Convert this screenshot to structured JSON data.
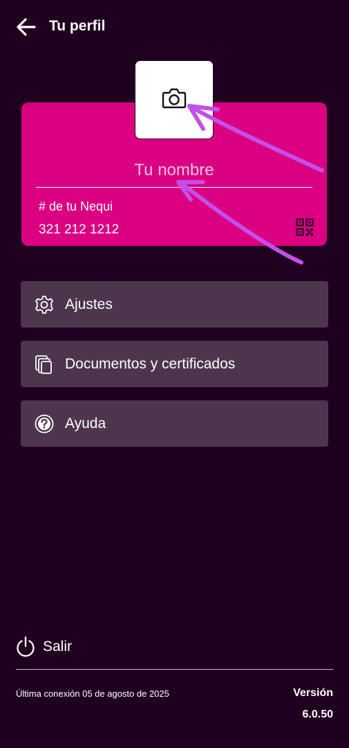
{
  "header": {
    "title": "Tu perfil",
    "back_icon": "arrow-left-icon"
  },
  "card": {
    "name_placeholder": "Tu nombre",
    "nequi_label": "# de tu Nequi",
    "nequi_number": "321 212 1212",
    "camera_icon": "camera-icon",
    "qr_icon": "qr-code-icon",
    "background_color": "#DA0081"
  },
  "menu": {
    "items": [
      {
        "label": "Ajustes",
        "icon": "gear-icon"
      },
      {
        "label": "Documentos y certificados",
        "icon": "documents-icon"
      },
      {
        "label": "Ayuda",
        "icon": "help-icon"
      }
    ]
  },
  "footer": {
    "logout_label": "Salir",
    "logout_icon": "power-icon",
    "last_connection": "Última conexión 05 de agosto de 2025",
    "version_label": "Versión",
    "version_number": "6.0.50"
  },
  "colors": {
    "background": "#200020",
    "menu_item": "#4D364D",
    "annotation": "#C44FE8"
  }
}
